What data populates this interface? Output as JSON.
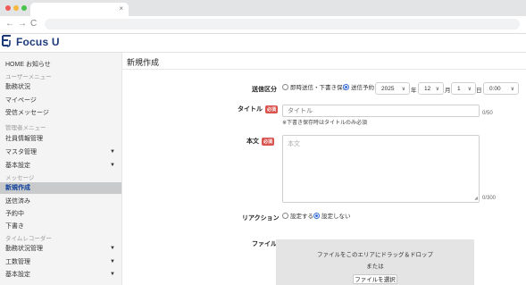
{
  "browser": {
    "tab_close": "×",
    "nav": {
      "back": "←",
      "forward": "→",
      "reload": "C"
    }
  },
  "app": {
    "logo_text": "Focus U",
    "brand_color": "#1d3a7a"
  },
  "sidebar": {
    "items": [
      {
        "label": "HOME お知らせ"
      },
      {
        "group": "ユーザーメニュー"
      },
      {
        "label": "勤務状況"
      },
      {
        "label": "マイページ"
      },
      {
        "label": "受信メッセージ"
      },
      {
        "group": "管理者メニュー"
      },
      {
        "label": "社員情報管理"
      },
      {
        "label": "マスタ管理",
        "expandable": true
      },
      {
        "label": "基本設定",
        "expandable": true
      },
      {
        "group": "メッセージ"
      },
      {
        "label": "新規作成",
        "active": true
      },
      {
        "label": "送信済み"
      },
      {
        "label": "予約中"
      },
      {
        "label": "下書き"
      },
      {
        "group": "タイムレコーダー"
      },
      {
        "label": "勤務状況管理",
        "expandable": true
      },
      {
        "label": "工数管理",
        "expandable": true
      },
      {
        "label": "基本設定",
        "expandable": true
      }
    ],
    "caret": "▼"
  },
  "main": {
    "title": "新規作成",
    "send_type": {
      "label": "送信区分",
      "options": [
        "即時送信・下書き保存",
        "送信予約"
      ],
      "selected": "送信予約",
      "year": "2025",
      "year_unit": "年",
      "month": "12",
      "month_unit": "月",
      "day": "1",
      "day_unit": "日",
      "time": "0:00"
    },
    "title_field": {
      "label": "タイトル",
      "required": "必須",
      "placeholder": "タイトル",
      "note": "※下書き保存時はタイトルのみ必須",
      "count": "0/50"
    },
    "body_field": {
      "label": "本文",
      "required": "必須",
      "placeholder": "本文",
      "count": "0/300"
    },
    "reaction": {
      "label": "リアクション",
      "options": [
        "設定する",
        "設定しない"
      ],
      "selected": "設定しない"
    },
    "file": {
      "label": "ファイル",
      "drop_text": "ファイルをこのエリアにドラッグ＆ドロップ",
      "or_text": "または",
      "button": "ファイルを選択"
    }
  }
}
